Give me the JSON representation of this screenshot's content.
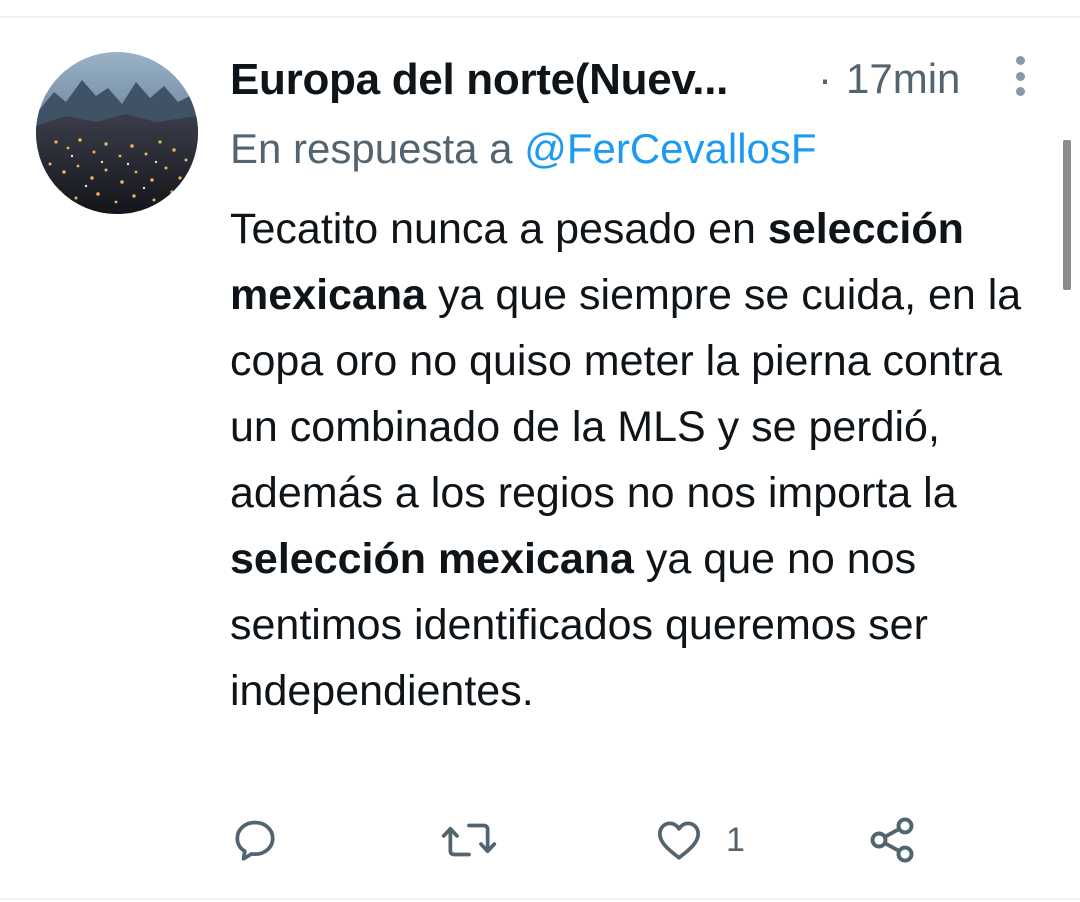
{
  "tweet": {
    "display_name": "Europa del norte(Nuev...",
    "time_separator": "·",
    "time": "17min",
    "reply_prefix": "En respuesta a",
    "reply_handle": "@FerCevallosF",
    "text_segments": [
      {
        "text": "Tecatito nunca a pesado en ",
        "bold": false
      },
      {
        "text": "selección mexicana",
        "bold": true
      },
      {
        "text": " ya que siempre se cuida, en la copa oro no quiso meter la pierna contra un combinado de la MLS y se perdió, además a los regios no nos importa la ",
        "bold": false
      },
      {
        "text": "selección mexicana",
        "bold": true
      },
      {
        "text": " ya que no nos sentimos identificados queremos ser independientes.",
        "bold": false
      }
    ],
    "like_count": "1"
  },
  "icons": {
    "avatar": "city-night-skyline-avatar",
    "more": "more-vertical-icon",
    "reply": "reply-icon",
    "retweet": "retweet-icon",
    "like": "heart-icon",
    "share": "share-icon"
  },
  "colors": {
    "text": "#0f1419",
    "secondary": "#536471",
    "link": "#1d9bf0",
    "icon": "#536471"
  }
}
